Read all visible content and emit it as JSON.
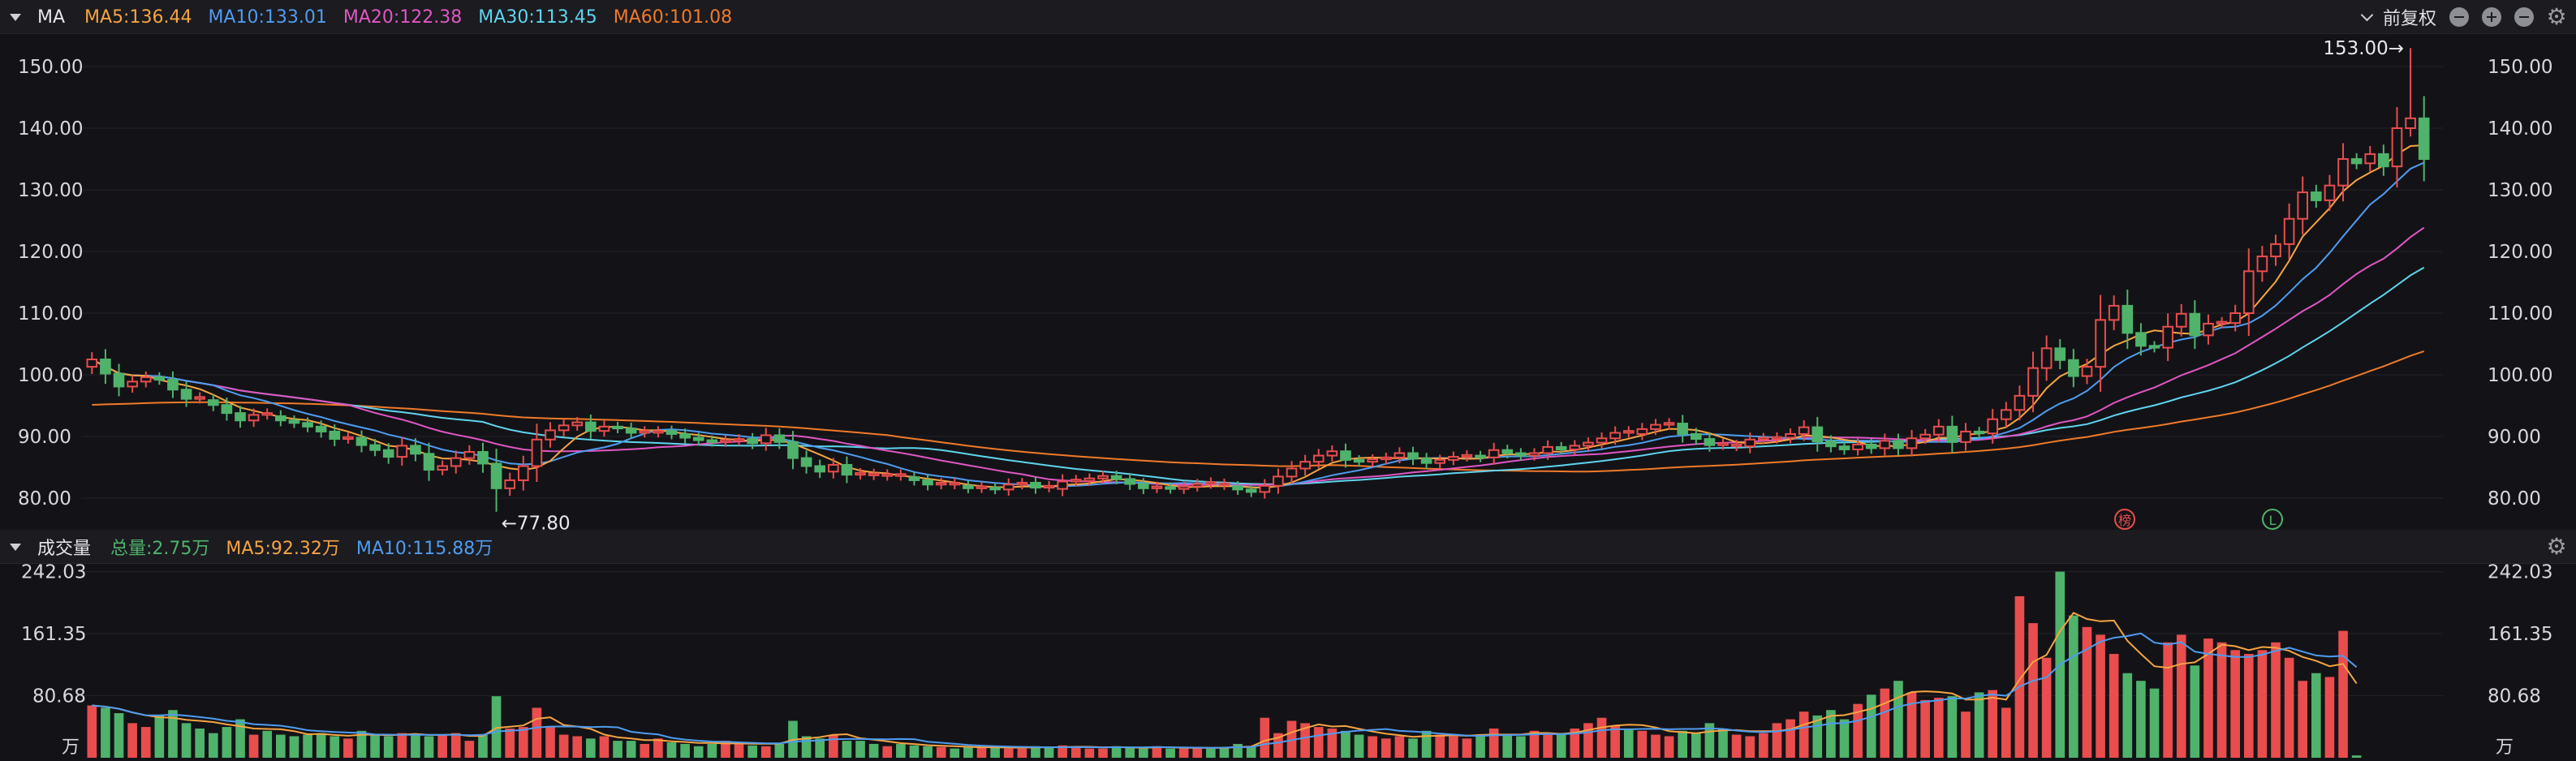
{
  "ma_panel": {
    "title": "MA",
    "ma5": "MA5:136.44",
    "ma10": "MA10:133.01",
    "ma20": "MA20:122.38",
    "ma30": "MA30:113.45",
    "ma60": "MA60:101.08",
    "adjust_label": "前复权",
    "colors": {
      "ma5": "#f5a442",
      "ma10": "#4f9cf0",
      "ma20": "#e056c4",
      "ma30": "#5fd4ee",
      "ma60": "#f07a2a",
      "up": "#e94d4d",
      "down": "#4fb36b"
    }
  },
  "vol_panel": {
    "title": "成交量",
    "total": "总量:2.75万",
    "ma5": "MA5:92.32万",
    "ma10": "MA10:115.88万",
    "unit": "万",
    "colors": {
      "total": "#4fb36b",
      "ma5": "#f5a442",
      "ma10": "#4f9cf0"
    }
  },
  "chart_data": [
    {
      "type": "candlestick",
      "ylim": [
        75,
        155
      ],
      "y_ticks": [
        "150.00",
        "140.00",
        "130.00",
        "120.00",
        "110.00",
        "100.00",
        "90.00",
        "80.00"
      ],
      "y_tick_values": [
        150,
        140,
        130,
        120,
        110,
        100,
        90,
        80
      ],
      "annotations": {
        "high": "153.00→",
        "high_value": 153.0,
        "low": "←77.80",
        "low_value": 77.8
      },
      "markers": [
        "榜",
        "L"
      ],
      "close": [
        102.5,
        100.2,
        98.1,
        98.9,
        99.6,
        99.2,
        97.6,
        96.1,
        95.9,
        95.1,
        93.8,
        92.6,
        93.5,
        93.3,
        92.6,
        92.2,
        91.6,
        90.8,
        89.6,
        89.8,
        88.6,
        87.8,
        86.7,
        88.5,
        87.2,
        84.6,
        85.2,
        86.5,
        87.5,
        85.6,
        81.6,
        82.9,
        85.2,
        89.5,
        91.0,
        91.8,
        92.3,
        90.9,
        91.6,
        91.3,
        90.6,
        90.6,
        90.9,
        90.4,
        89.8,
        89.4,
        89.1,
        89.3,
        89.6,
        88.9,
        90.2,
        89.1,
        86.5,
        85.2,
        84.3,
        85.4,
        83.8,
        83.7,
        83.6,
        83.6,
        83.4,
        82.9,
        82.2,
        82.2,
        82.0,
        81.6,
        81.7,
        81.4,
        82.2,
        82.5,
        81.7,
        81.5,
        82.7,
        82.8,
        83.2,
        83.6,
        83.1,
        82.3,
        81.6,
        81.8,
        81.5,
        81.9,
        82.3,
        82.1,
        81.9,
        81.4,
        81.0,
        82.0,
        83.5,
        84.8,
        85.9,
        86.9,
        87.6,
        86.2,
        85.9,
        86.3,
        86.6,
        87.3,
        86.4,
        85.7,
        86.2,
        86.7,
        86.9,
        86.6,
        87.8,
        87.3,
        86.9,
        87.3,
        88.3,
        87.9,
        88.5,
        89.0,
        89.7,
        90.6,
        90.4,
        91.2,
        91.9,
        92.1,
        90.4,
        89.6,
        88.6,
        88.4,
        88.4,
        89.5,
        89.6,
        89.8,
        90.4,
        91.5,
        89.2,
        88.4,
        87.9,
        88.7,
        88.1,
        89.3,
        88.1,
        89.7,
        90.3,
        91.6,
        89.1,
        90.8,
        90.5,
        92.8,
        94.3,
        96.6,
        101.1,
        104.3,
        102.4,
        99.8,
        101.3,
        108.9,
        111.2,
        106.8,
        104.7,
        104.4,
        107.8,
        109.9,
        106.4,
        108.3,
        108.4,
        110.0,
        116.8,
        119.2,
        121.2,
        125.3,
        129.6,
        128.3,
        130.7,
        135.0,
        134.3,
        135.8,
        133.8,
        140.0,
        141.6,
        135.0
      ],
      "volume": [
        68,
        65,
        58,
        45,
        40,
        55,
        62,
        45,
        38,
        32,
        40,
        50,
        30,
        35,
        30,
        28,
        30,
        32,
        28,
        25,
        35,
        30,
        28,
        32,
        30,
        28,
        30,
        32,
        22,
        30,
        80,
        38,
        40,
        65,
        40,
        30,
        28,
        25,
        28,
        22,
        22,
        18,
        25,
        20,
        18,
        15,
        18,
        22,
        20,
        16,
        15,
        18,
        48,
        28,
        25,
        30,
        22,
        22,
        18,
        15,
        18,
        16,
        15,
        14,
        12,
        14,
        13,
        15,
        12,
        12,
        15,
        14,
        16,
        14,
        12,
        12,
        15,
        14,
        12,
        15,
        12,
        12,
        14,
        12,
        14,
        18,
        15,
        52,
        32,
        48,
        45,
        40,
        38,
        35,
        30,
        28,
        25,
        28,
        25,
        35,
        30,
        28,
        25,
        30,
        38,
        30,
        28,
        35,
        30,
        32,
        38,
        45,
        52,
        42,
        38,
        35,
        30,
        28,
        35,
        32,
        45,
        38,
        30,
        28,
        32,
        45,
        50,
        60,
        55,
        62,
        50,
        70,
        82,
        90,
        100,
        85,
        75,
        78,
        80,
        60,
        85,
        88,
        65,
        210,
        175,
        130,
        242,
        185,
        170,
        160,
        135,
        110,
        100,
        90,
        150,
        160,
        120,
        155,
        150,
        140,
        135,
        140,
        150,
        130,
        100,
        110,
        105,
        165,
        3
      ]
    }
  ]
}
